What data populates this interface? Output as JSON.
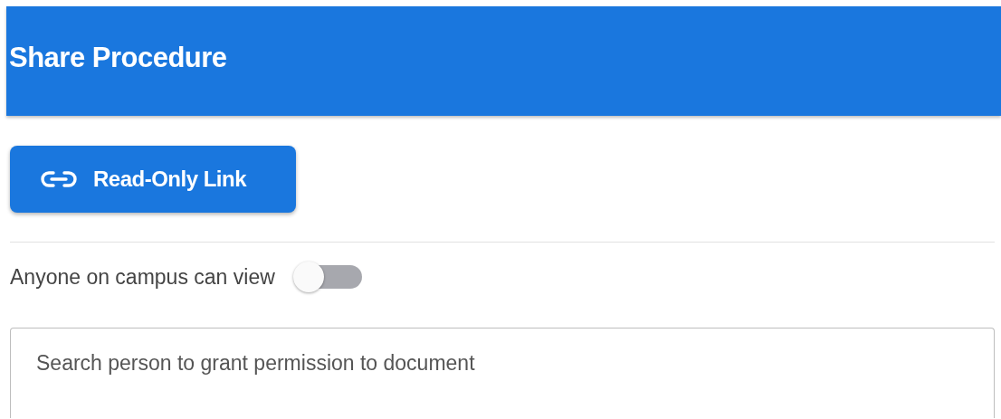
{
  "dialog": {
    "title": "Share Procedure"
  },
  "link_button": {
    "label": "Read-Only Link"
  },
  "campus_toggle": {
    "label": "Anyone on campus can view",
    "on": false
  },
  "search": {
    "placeholder": "Search person to grant permission to document"
  }
}
